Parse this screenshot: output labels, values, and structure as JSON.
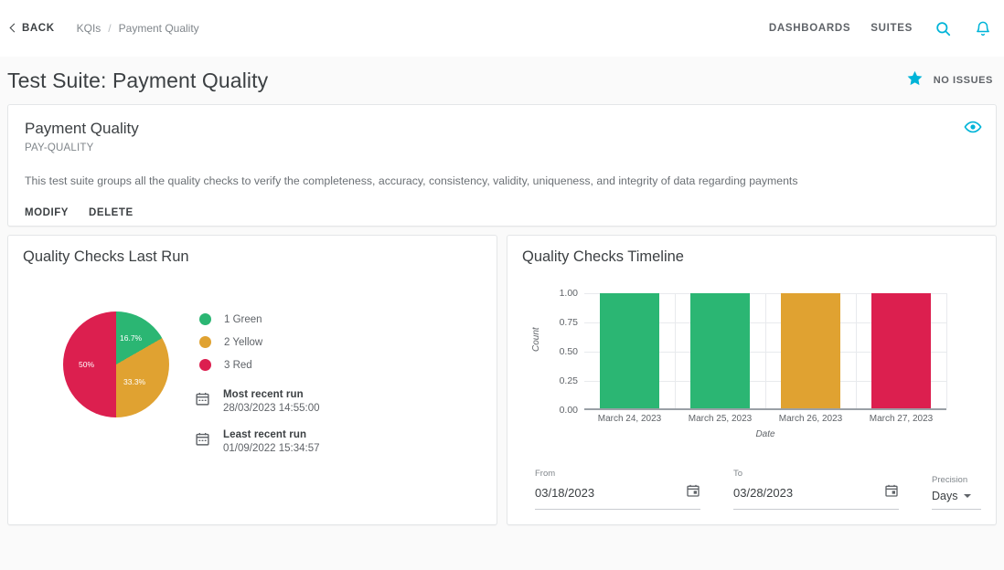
{
  "topbar": {
    "back_label": "BACK",
    "breadcrumb": [
      "KQIs",
      "Payment Quality"
    ],
    "breadcrumb_separator": "/",
    "nav": [
      {
        "label": "DASHBOARDS"
      },
      {
        "label": "SUITES"
      }
    ],
    "icons": {
      "search": "search-icon",
      "notifications": "bell-icon"
    },
    "accent_color": "#00b4d8"
  },
  "page": {
    "title": "Test Suite: Payment Quality",
    "status_label": "NO ISSUES",
    "status_icon": "star-icon",
    "status_color": "#00b4d8",
    "background": "#fafafa"
  },
  "info_card": {
    "title": "Payment Quality",
    "code": "PAY-QUALITY",
    "description": "This test suite groups all the quality checks to verify the completeness, accuracy, consistency, validity, uniqueness, and integrity of data regarding payments",
    "actions": [
      {
        "label": "MODIFY"
      },
      {
        "label": "DELETE"
      }
    ],
    "visibility_icon": "eye-icon"
  },
  "pie_panel": {
    "title": "Quality Checks Last Run",
    "legend": [
      {
        "label": "1 Green",
        "color": "#2bb673"
      },
      {
        "label": "2 Yellow",
        "color": "#e0a231"
      },
      {
        "label": "3 Red",
        "color": "#dc1f4f"
      }
    ],
    "runs": [
      {
        "icon": "calendar-icon",
        "title": "Most recent run",
        "date": "28/03/2023 14:55:00"
      },
      {
        "icon": "calendar-icon",
        "title": "Least recent run",
        "date": "01/09/2022 15:34:57"
      }
    ]
  },
  "timeline_panel": {
    "title": "Quality Checks Timeline",
    "filters": {
      "from": {
        "label": "From",
        "value": "03/18/2023",
        "icon": "calendar-icon"
      },
      "to": {
        "label": "To",
        "value": "03/28/2023",
        "icon": "calendar-icon"
      },
      "precision": {
        "label": "Precision",
        "value": "Days",
        "icon": "chevron-down-icon"
      }
    }
  },
  "chart_data": [
    {
      "type": "pie",
      "title": "Quality Checks Last Run",
      "labels": [
        "1 Green",
        "2 Yellow",
        "3 Red"
      ],
      "values": [
        16.7,
        33.3,
        50
      ],
      "counts": [
        1,
        2,
        3
      ],
      "data_labels": [
        "16.7%",
        "33.3%",
        "50%"
      ],
      "colors": [
        "#2bb673",
        "#e0a231",
        "#dc1f4f"
      ],
      "legend_position": "right",
      "start_angle": 0
    },
    {
      "type": "bar",
      "title": "Quality Checks Timeline",
      "categories": [
        "March 24, 2023",
        "March 25, 2023",
        "March 26, 2023",
        "March 27, 2023"
      ],
      "values": [
        1.0,
        1.0,
        1.0,
        1.0
      ],
      "colors": [
        "#2bb673",
        "#2bb673",
        "#e0a231",
        "#dc1f4f"
      ],
      "xlabel": "Date",
      "ylabel": "Count",
      "ylim": [
        0.0,
        1.0
      ],
      "yticks": [
        "0.00",
        "0.25",
        "0.50",
        "0.75",
        "1.00"
      ],
      "ytick_values": [
        0.0,
        0.25,
        0.5,
        0.75,
        1.0
      ],
      "grid": true,
      "legend_position": "none"
    }
  ]
}
